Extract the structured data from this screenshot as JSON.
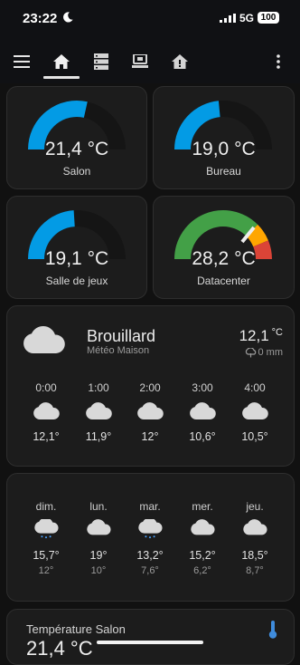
{
  "status_bar": {
    "time": "23:22",
    "network": "5G",
    "battery": "100"
  },
  "toolbar": {
    "menu_icon": "hamburger-icon",
    "tabs": [
      {
        "icon": "home-icon",
        "active": true
      },
      {
        "icon": "server-icon",
        "active": false
      },
      {
        "icon": "computer-icon",
        "active": false
      },
      {
        "icon": "home-alert-icon",
        "active": false
      }
    ],
    "more_icon": "more-vertical-icon"
  },
  "gauges": [
    {
      "value": "21,4 °C",
      "name": "Salon",
      "fraction": 0.57,
      "color": "#039be5"
    },
    {
      "value": "19,0 °C",
      "name": "Bureau",
      "fraction": 0.47,
      "color": "#039be5"
    },
    {
      "value": "19,1 °C",
      "name": "Salle de jeux",
      "fraction": 0.48,
      "color": "#039be5"
    },
    {
      "value": "28,2 °C",
      "name": "Datacenter",
      "fraction": 0.74,
      "segments": [
        "#43a047",
        "#ffa600",
        "#db4437"
      ]
    }
  ],
  "weather": {
    "condition": "Brouillard",
    "source": "Météo Maison",
    "temperature": "12,1",
    "unit": "°C",
    "precipitation": "0 mm",
    "hourly": [
      {
        "time": "0:00",
        "temp": "12,1°"
      },
      {
        "time": "1:00",
        "temp": "11,9°"
      },
      {
        "time": "2:00",
        "temp": "12°"
      },
      {
        "time": "3:00",
        "temp": "10,6°"
      },
      {
        "time": "4:00",
        "temp": "10,5°"
      }
    ]
  },
  "daily": [
    {
      "day": "dim.",
      "high": "15,7°",
      "low": "12°",
      "icon": "rain-cloud-icon"
    },
    {
      "day": "lun.",
      "high": "19°",
      "low": "10°",
      "icon": "cloud-icon"
    },
    {
      "day": "mar.",
      "high": "13,2°",
      "low": "7,6°",
      "icon": "rain-cloud-icon"
    },
    {
      "day": "mer.",
      "high": "15,2°",
      "low": "6,2°",
      "icon": "cloud-icon"
    },
    {
      "day": "jeu.",
      "high": "18,5°",
      "low": "8,7°",
      "icon": "cloud-icon"
    }
  ],
  "sensor": {
    "title": "Température Salon",
    "value": "21,4 °C"
  },
  "colors": {
    "accent": "#039be5",
    "card": "#1c1c1c",
    "background": "#111111"
  }
}
